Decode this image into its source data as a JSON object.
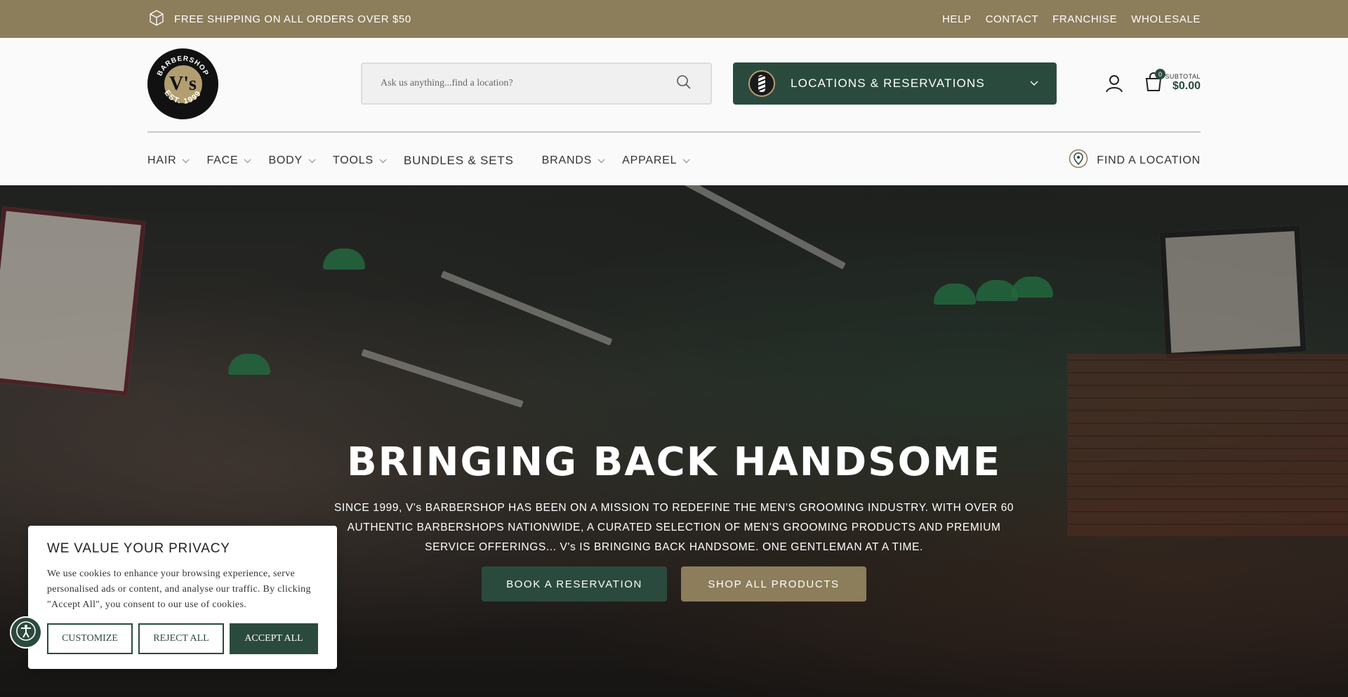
{
  "topbar": {
    "shipping": "FREE SHIPPING ON ALL ORDERS OVER $50",
    "links": [
      "HELP",
      "CONTACT",
      "FRANCHISE",
      "WHOLESALE"
    ]
  },
  "header": {
    "logo_top": "BARBERSHOP",
    "logo_mark": "V's",
    "logo_bottom": "EST. 1999",
    "search_placeholder": "Ask us anything...find a location?",
    "locations_button": "LOCATIONS & RESERVATIONS",
    "cart_count": "0",
    "subtotal_label": "SUBTOTAL",
    "subtotal_amount": "$0.00"
  },
  "nav": {
    "items": [
      {
        "label": "HAIR"
      },
      {
        "label": "FACE"
      },
      {
        "label": "BODY"
      },
      {
        "label": "TOOLS"
      },
      {
        "label": "BUNDLES & SETS"
      },
      {
        "label": "BRANDS"
      },
      {
        "label": "APPAREL"
      }
    ],
    "find_location": "FIND A LOCATION"
  },
  "hero": {
    "title": "BRINGING BACK HANDSOME",
    "body": "SINCE 1999, V's BARBERSHOP HAS BEEN ON A MISSION TO REDEFINE THE MEN'S GROOMING INDUSTRY. WITH OVER 60 AUTHENTIC BARBERSHOPS NATIONWIDE, A CURATED SELECTION OF MEN'S GROOMING PRODUCTS AND PREMIUM SERVICE OFFERINGS... V's IS BRINGING BACK HANDSOME. ONE GENTLEMAN AT A TIME.",
    "book_button": "BOOK A RESERVATION",
    "shop_button": "SHOP ALL PRODUCTS"
  },
  "cookie": {
    "title": "WE VALUE YOUR PRIVACY",
    "text": "We use cookies to enhance your browsing experience, serve personalised ads or content, and analyse our traffic. By clicking \"Accept All\", you consent to our use of cookies.",
    "customize": "CUSTOMIZE",
    "reject": "REJECT ALL",
    "accept": "ACCEPT ALL"
  },
  "colors": {
    "gold": "#8c7d5b",
    "green": "#2b4a3e"
  }
}
